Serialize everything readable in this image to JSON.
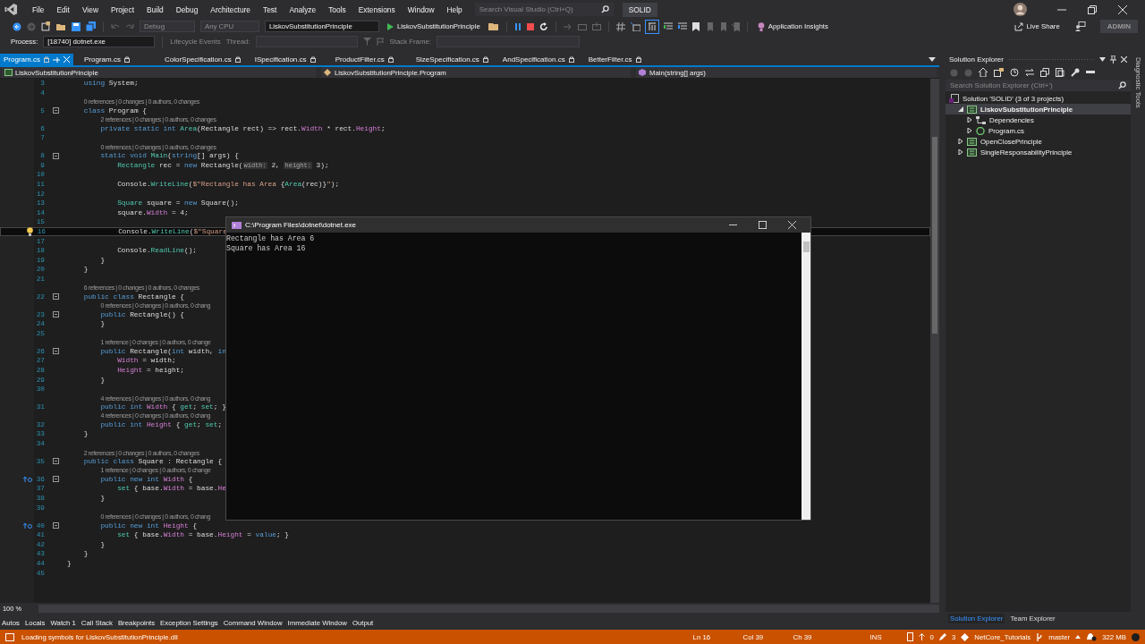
{
  "menu_bar": {
    "items": [
      "File",
      "Edit",
      "View",
      "Project",
      "Build",
      "Debug",
      "Architecture",
      "Test",
      "Analyze",
      "Tools",
      "Extensions",
      "Window",
      "Help"
    ],
    "search": {
      "placeholder": "Search Visual Studio (Ctrl+Q)"
    },
    "solution_name": "SOLID"
  },
  "toolbar": {
    "configuration": {
      "value": "Debug",
      "disabled": true
    },
    "platform": {
      "value": "Any CPU",
      "disabled": true
    },
    "startup_project": "LiskovSubstitutionPrinciple",
    "run_target": "LiskovSubstitutionPrinciple",
    "application_insights": "Application Insights",
    "live_share": "Live Share",
    "account": "ADMIN"
  },
  "debug_bar": {
    "process_label": "Process:",
    "process": "[18740] dotnet.exe",
    "lifecycle_events": "Lifecycle Events",
    "thread_label": "Thread:",
    "stack_frame_label": "Stack Frame:"
  },
  "tabs": [
    {
      "label": "Program.cs",
      "selected": true
    },
    {
      "label": "Program.cs",
      "selected": false
    },
    {
      "label": "ColorSpecification.cs",
      "selected": false
    },
    {
      "label": "ISpecification.cs",
      "selected": false
    },
    {
      "label": "ProductFilter.cs",
      "selected": false
    },
    {
      "label": "SizeSpecification.cs",
      "selected": false
    },
    {
      "label": "AndSpecification.cs",
      "selected": false
    },
    {
      "label": "BetterFilter.cs",
      "selected": false
    }
  ],
  "navigation_bar": {
    "project": "LiskovSubstitutionPrinciple",
    "type": "LiskovSubstitutionPrinciple.Program",
    "member": "Main(string[] args)"
  },
  "editor": {
    "zoom": "100 %",
    "lines": [
      {
        "number": "3",
        "tokens": [
          {
            "t": "    using",
            "kind": "kw"
          },
          {
            "t": " System;",
            "kind": "plain"
          }
        ]
      },
      {
        "number": "4"
      },
      {
        "number": "5",
        "lens": "0 references | 0 changes | 0 authors, 0 changes",
        "fold": true,
        "tokens": [
          {
            "t": "    class",
            "kind": "kw"
          },
          {
            "t": " Program {",
            "kind": "plain"
          }
        ]
      },
      {
        "number": "6",
        "lens": "2 references | 0 changes | 0 authors, 0 changes",
        "tokens": [
          {
            "t": "        private static int ",
            "kind": "kw"
          },
          {
            "t": "Area",
            "kind": "method"
          },
          {
            "t": "(Rectangle rect) => rect.",
            "kind": "plain"
          },
          {
            "t": "Width",
            "kind": "prop"
          },
          {
            "t": " * rect.",
            "kind": "plain"
          },
          {
            "t": "Height",
            "kind": "prop"
          },
          {
            "t": ";",
            "kind": "plain"
          }
        ]
      },
      {
        "number": "7"
      },
      {
        "number": "8",
        "lens": "0 references | 0 changes | 0 authors, 0 changes",
        "fold": true,
        "tokens": [
          {
            "t": "        static void ",
            "kind": "kw"
          },
          {
            "t": "Main",
            "kind": "method"
          },
          {
            "t": "(",
            "kind": "plain"
          },
          {
            "t": "string",
            "kind": "kw"
          },
          {
            "t": "[] args) {",
            "kind": "plain"
          }
        ]
      },
      {
        "number": "9",
        "tokens": [
          {
            "t": "            Rectangle",
            "kind": "type"
          },
          {
            "t": " rec = ",
            "kind": "plain"
          },
          {
            "t": "new",
            "kind": "kw"
          },
          {
            "t": " Rectangle(",
            "kind": "plain"
          },
          {
            "t": "width:",
            "kind": "hint"
          },
          {
            "t": " 2, ",
            "kind": "plain"
          },
          {
            "t": "height:",
            "kind": "hint"
          },
          {
            "t": " 3);",
            "kind": "plain"
          }
        ]
      },
      {
        "number": "10"
      },
      {
        "number": "11",
        "tokens": [
          {
            "t": "            Console.",
            "kind": "plain"
          },
          {
            "t": "WriteLine",
            "kind": "method"
          },
          {
            "t": "(",
            "kind": "plain"
          },
          {
            "t": "$\"Rectangle has Area ",
            "kind": "str"
          },
          {
            "t": "{",
            "kind": "plain"
          },
          {
            "t": "Area",
            "kind": "method"
          },
          {
            "t": "(rec)}",
            "kind": "plain"
          },
          {
            "t": "\"",
            "kind": "str"
          },
          {
            "t": ");",
            "kind": "plain"
          }
        ]
      },
      {
        "number": "12"
      },
      {
        "number": "13",
        "tokens": [
          {
            "t": "            Square",
            "kind": "type"
          },
          {
            "t": " square = ",
            "kind": "plain"
          },
          {
            "t": "new",
            "kind": "kw"
          },
          {
            "t": " Square();",
            "kind": "plain"
          }
        ]
      },
      {
        "number": "14",
        "tokens": [
          {
            "t": "            square.",
            "kind": "plain"
          },
          {
            "t": "Width",
            "kind": "prop"
          },
          {
            "t": " = 4;",
            "kind": "plain"
          }
        ]
      },
      {
        "number": "15"
      },
      {
        "number": "16",
        "current": true,
        "lightbulb": true,
        "tokens": [
          {
            "t": "            Console.",
            "kind": "plain"
          },
          {
            "t": "WriteLine",
            "kind": "method"
          },
          {
            "t": "(",
            "kind": "plain"
          },
          {
            "t": "$\"Square",
            "kind": "str"
          }
        ]
      },
      {
        "number": "17"
      },
      {
        "number": "18",
        "tokens": [
          {
            "t": "            Console.",
            "kind": "plain"
          },
          {
            "t": "ReadLine",
            "kind": "method"
          },
          {
            "t": "();",
            "kind": "plain"
          }
        ]
      },
      {
        "number": "19",
        "tokens": [
          {
            "t": "        }",
            "kind": "plain"
          }
        ]
      },
      {
        "number": "20",
        "tokens": [
          {
            "t": "    }",
            "kind": "plain"
          }
        ]
      },
      {
        "number": "21"
      },
      {
        "number": "22",
        "lens": "6 references | 0 changes | 0 authors, 0 changes",
        "fold": true,
        "tokens": [
          {
            "t": "    public class",
            "kind": "kw"
          },
          {
            "t": " Rectangle {",
            "kind": "plain"
          }
        ]
      },
      {
        "number": "23",
        "lens": "0 references | 0 changes | 0 authors, 0 chang",
        "fold": true,
        "tokens": [
          {
            "t": "        public",
            "kind": "kw"
          },
          {
            "t": " Rectangle() {",
            "kind": "plain"
          }
        ]
      },
      {
        "number": "24",
        "tokens": [
          {
            "t": "        }",
            "kind": "plain"
          }
        ]
      },
      {
        "number": "25"
      },
      {
        "number": "26",
        "lens": "1 reference | 0 changes | 0 authors, 0 change",
        "fold": true,
        "tokens": [
          {
            "t": "        public",
            "kind": "kw"
          },
          {
            "t": " Rectangle(",
            "kind": "plain"
          },
          {
            "t": "int",
            "kind": "kw"
          },
          {
            "t": " width, ",
            "kind": "plain"
          },
          {
            "t": "in",
            "kind": "kw"
          }
        ]
      },
      {
        "number": "27",
        "tokens": [
          {
            "t": "            Width",
            "kind": "prop"
          },
          {
            "t": " = width;",
            "kind": "plain"
          }
        ]
      },
      {
        "number": "28",
        "tokens": [
          {
            "t": "            Height",
            "kind": "prop"
          },
          {
            "t": " = height;",
            "kind": "plain"
          }
        ]
      },
      {
        "number": "29",
        "tokens": [
          {
            "t": "        }",
            "kind": "plain"
          }
        ]
      },
      {
        "number": "30"
      },
      {
        "number": "31",
        "lens": "4 references | 0 changes | 0 authors, 0 chang",
        "tokens": [
          {
            "t": "        public int ",
            "kind": "kw"
          },
          {
            "t": "Width",
            "kind": "prop"
          },
          {
            "t": " { ",
            "kind": "plain"
          },
          {
            "t": "get",
            "kind": "accessor"
          },
          {
            "t": "; ",
            "kind": "plain"
          },
          {
            "t": "set",
            "kind": "accessor"
          },
          {
            "t": "; }",
            "kind": "plain"
          }
        ]
      },
      {
        "number": "32",
        "lens": "4 references | 0 changes | 0 authors, 0 chang",
        "tokens": [
          {
            "t": "        public int ",
            "kind": "kw"
          },
          {
            "t": "Height",
            "kind": "prop"
          },
          {
            "t": " { ",
            "kind": "plain"
          },
          {
            "t": "get",
            "kind": "accessor"
          },
          {
            "t": "; ",
            "kind": "plain"
          },
          {
            "t": "set",
            "kind": "accessor"
          },
          {
            "t": ";",
            "kind": "plain"
          }
        ]
      },
      {
        "number": "33",
        "tokens": [
          {
            "t": "    }",
            "kind": "plain"
          }
        ]
      },
      {
        "number": "34"
      },
      {
        "number": "35",
        "lens": "2 references | 0 changes | 0 authors, 0 changes",
        "fold": true,
        "tokens": [
          {
            "t": "    public class",
            "kind": "kw"
          },
          {
            "t": " Square : Rectangle {",
            "kind": "plain"
          }
        ]
      },
      {
        "number": "36",
        "lens": "1 reference | 0 changes | 0 authors, 0 change",
        "fold": true,
        "override": true,
        "tokens": [
          {
            "t": "        public new int ",
            "kind": "kw"
          },
          {
            "t": "Width",
            "kind": "prop"
          },
          {
            "t": " {",
            "kind": "plain"
          }
        ]
      },
      {
        "number": "37",
        "tokens": [
          {
            "t": "            set",
            "kind": "accessor"
          },
          {
            "t": " { base.",
            "kind": "plain"
          },
          {
            "t": "Width",
            "kind": "prop"
          },
          {
            "t": " = base.",
            "kind": "plain"
          },
          {
            "t": "He",
            "kind": "prop"
          }
        ]
      },
      {
        "number": "38",
        "tokens": [
          {
            "t": "        }",
            "kind": "plain"
          }
        ]
      },
      {
        "number": "39"
      },
      {
        "number": "40",
        "lens": "0 references | 0 changes | 0 authors, 0 chang",
        "fold": true,
        "override": true,
        "tokens": [
          {
            "t": "        public new int ",
            "kind": "kw"
          },
          {
            "t": "Height",
            "kind": "prop"
          },
          {
            "t": " {",
            "kind": "plain"
          }
        ]
      },
      {
        "number": "41",
        "tokens": [
          {
            "t": "            set",
            "kind": "accessor"
          },
          {
            "t": " { base.",
            "kind": "plain"
          },
          {
            "t": "Width",
            "kind": "prop"
          },
          {
            "t": " = base.",
            "kind": "plain"
          },
          {
            "t": "Height",
            "kind": "prop"
          },
          {
            "t": " = ",
            "kind": "plain"
          },
          {
            "t": "value",
            "kind": "kw"
          },
          {
            "t": "; }",
            "kind": "plain"
          }
        ]
      },
      {
        "number": "42",
        "tokens": [
          {
            "t": "        }",
            "kind": "plain"
          }
        ]
      },
      {
        "number": "43",
        "tokens": [
          {
            "t": "    }",
            "kind": "plain"
          }
        ]
      },
      {
        "number": "44",
        "tokens": [
          {
            "t": "}",
            "kind": "plain"
          }
        ]
      },
      {
        "number": "45"
      }
    ]
  },
  "console": {
    "title": "C:\\Program Files\\dotnet\\dotnet.exe",
    "output": [
      "Rectangle has Area 6",
      "Square has Area 16"
    ]
  },
  "solution_explorer": {
    "title": "Solution Explorer",
    "search": {
      "placeholder": "Search Solution Explorer (Ctrl+')"
    },
    "tree": [
      {
        "label": "Solution 'SOLID' (3 of 3 projects)",
        "kind": "solution",
        "selected": false,
        "children": [
          {
            "label": "LiskovSubstitutionPrinciple",
            "kind": "project",
            "expanded": true,
            "selected": true,
            "children": [
              {
                "label": "Dependencies",
                "kind": "dependencies",
                "expanded": false,
                "selected": false
              },
              {
                "label": "Program.cs",
                "kind": "file",
                "expanded": false,
                "selected": false
              }
            ]
          },
          {
            "label": "OpenClosePrinciple",
            "kind": "project",
            "expanded": false,
            "selected": false
          },
          {
            "label": "SingleResponsabilityPrinciple",
            "kind": "project",
            "expanded": false,
            "selected": false
          }
        ]
      }
    ],
    "tabs": [
      {
        "label": "Solution Explorer",
        "selected": true
      },
      {
        "label": "Team Explorer",
        "selected": false
      }
    ]
  },
  "side_tab": "Diagnostic Tools",
  "bottom_tabs": [
    "Autos",
    "Locals",
    "Watch 1",
    "Call Stack",
    "Breakpoints",
    "Exception Settings",
    "Command Window",
    "Immediate Window",
    "Output"
  ],
  "status_bar": {
    "message": "Loading symbols for LiskovSubstitutionPrinciple.dll",
    "line": "Ln 16",
    "column": "Col 39",
    "char": "Ch 39",
    "mode": "INS",
    "pushes": "0",
    "changes": "3",
    "repository": "NetCore_Tutorials",
    "branch": "master",
    "memory": "322 MB"
  }
}
